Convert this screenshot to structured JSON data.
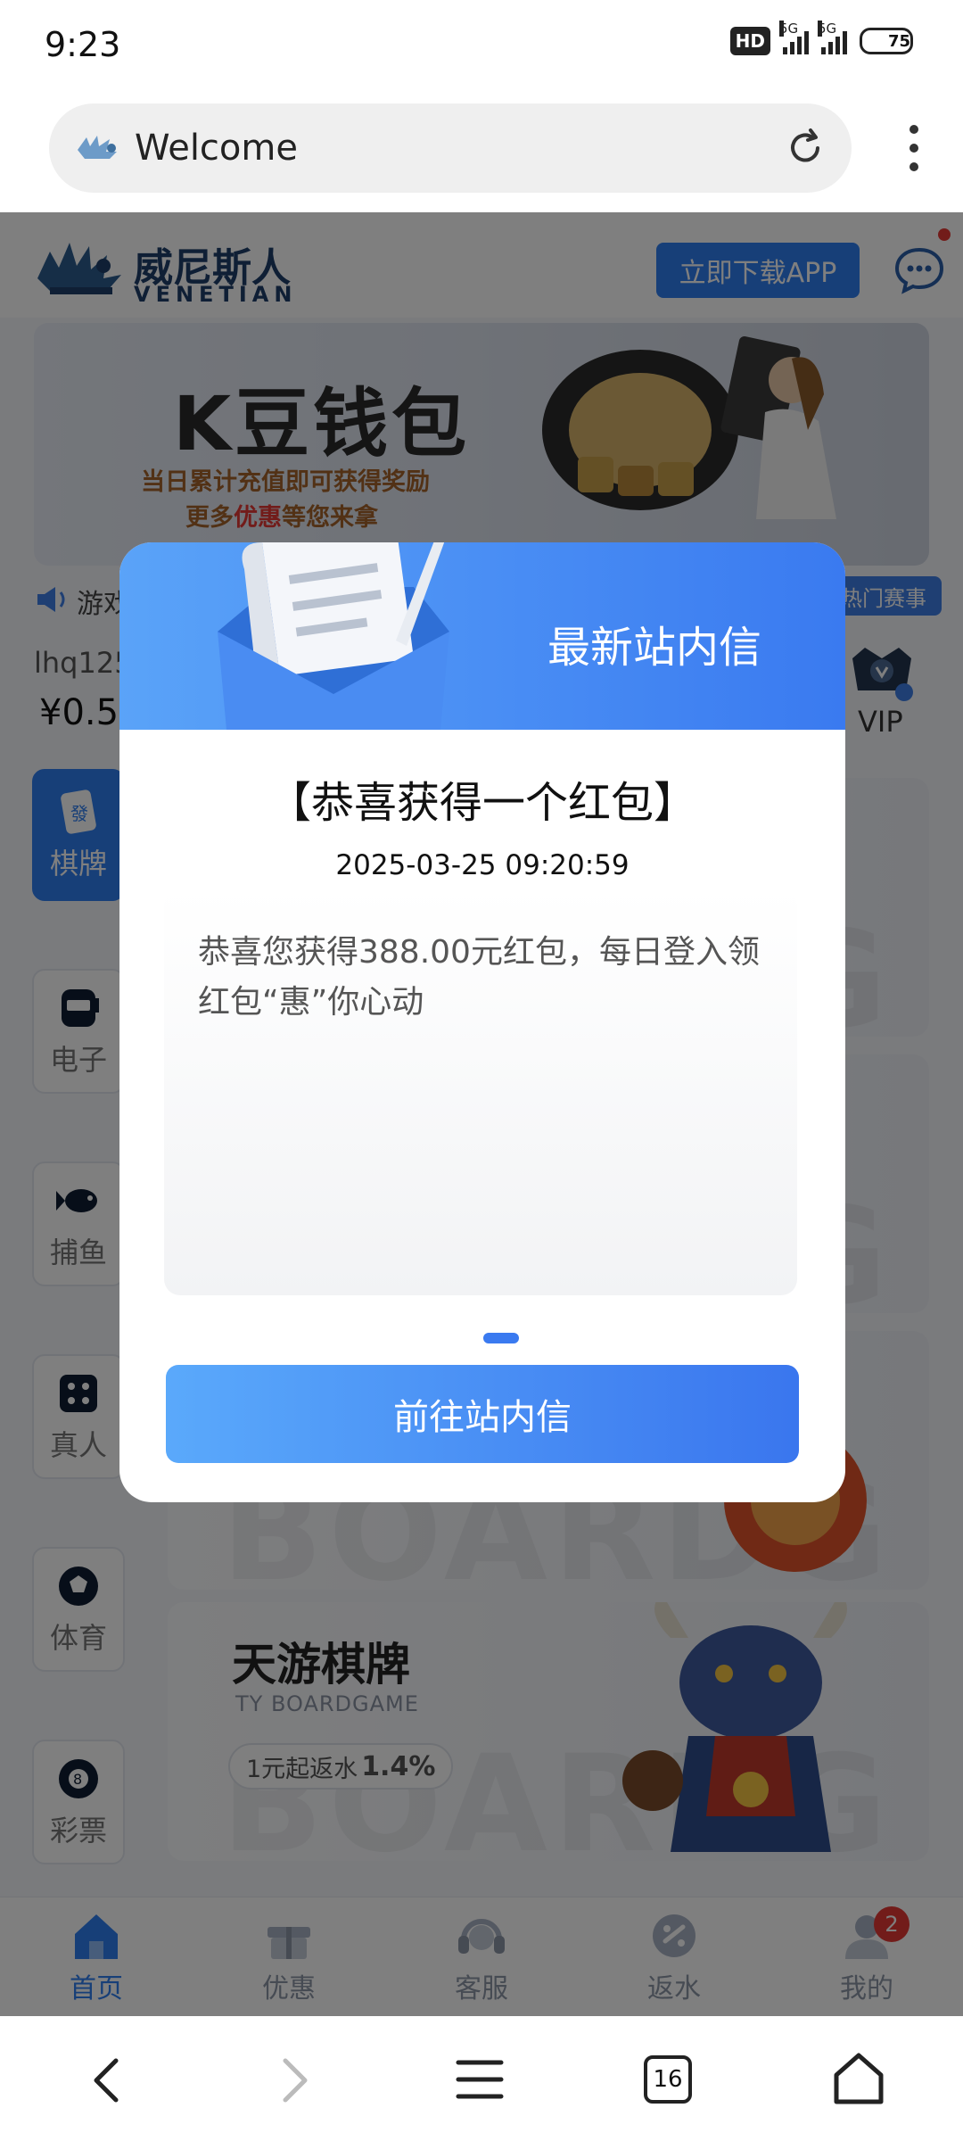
{
  "status_bar": {
    "time": "9:23",
    "hd_label": "HD",
    "sim1_label": "5G",
    "sim2_label": "5G",
    "battery": "75",
    "battery_level_percent": 75
  },
  "browser": {
    "address_text": "Welcome",
    "site_icon": "winged-lion-icon",
    "reload_icon": "reload-icon",
    "menu_icon": "more-vertical-icon"
  },
  "header": {
    "logo_cn": "威尼斯人",
    "logo_en": "VENETIAN",
    "download_label": "立即下载APP",
    "chat_icon": "chat-icon"
  },
  "banner": {
    "title": "K豆钱包",
    "subtitle_line1": "当日累计充值即可获得奖励",
    "subtitle_line2_prefix": "更多",
    "subtitle_line2_highlight": "优惠",
    "subtitle_line2_suffix": "等您来拿"
  },
  "notice": {
    "text": "游戏",
    "hot_tag": "热门赛事"
  },
  "user": {
    "name": "lhq125",
    "balance": "¥0.5",
    "vip_label": "VIP"
  },
  "side_nav": [
    {
      "label": "棋牌",
      "icon": "mahjong-tile-icon",
      "active": true
    },
    {
      "label": "电子",
      "icon": "slot-machine-icon",
      "active": false
    },
    {
      "label": "捕鱼",
      "icon": "fish-icon",
      "active": false
    },
    {
      "label": "真人",
      "icon": "dice-icon",
      "active": false
    },
    {
      "label": "体育",
      "icon": "soccer-ball-icon",
      "active": false
    },
    {
      "label": "彩票",
      "icon": "lottery-ball-icon",
      "active": false
    }
  ],
  "game_card": {
    "title": "天游棋牌",
    "subtitle": "TY BOARDGAME",
    "rebate_prefix": "1元起返水",
    "rebate_value": "1.4%",
    "bg_text": "BOARDG"
  },
  "bottom_tabs": [
    {
      "label": "首页",
      "icon": "home-icon",
      "active": true
    },
    {
      "label": "优惠",
      "icon": "gift-icon",
      "active": false
    },
    {
      "label": "客服",
      "icon": "headset-icon",
      "active": false
    },
    {
      "label": "返水",
      "icon": "rebate-icon",
      "active": false
    },
    {
      "label": "我的",
      "icon": "user-icon",
      "active": false,
      "badge": "2"
    }
  ],
  "modal": {
    "header_title": "最新站内信",
    "message_title": "【恭喜获得一个红包】",
    "message_time": "2025-03-25 09:20:59",
    "message_body": "恭喜您获得388.00元红包，每日登入领红包“惠”你心动",
    "button_label": "前往站内信"
  },
  "system_nav": {
    "tab_count": "16"
  },
  "colors": {
    "accent": "#2f7ef0",
    "modal_header": "#3a7af0",
    "badge": "#e53935"
  }
}
